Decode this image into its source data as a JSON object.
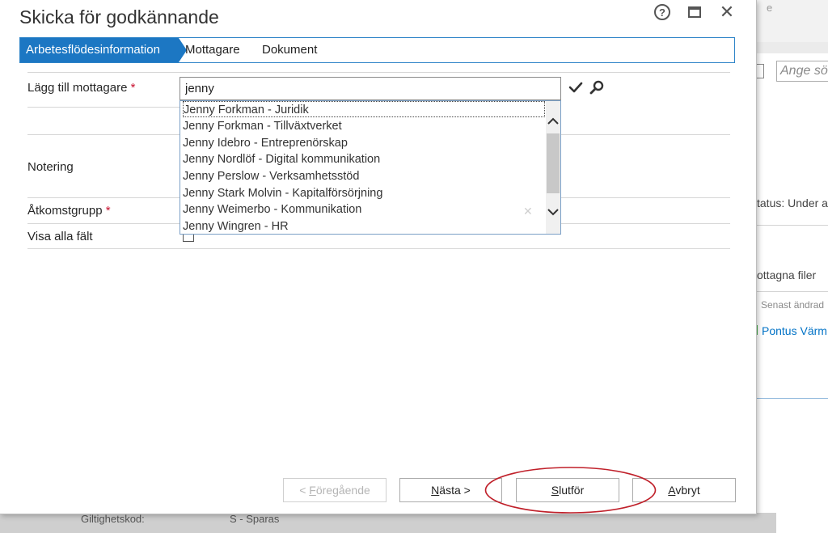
{
  "background": {
    "top_text": "e",
    "search_placeholder": "Ange sö",
    "status_text": "tatus: Under a",
    "files_heading": "ottagna filer",
    "last_changed": "Senast ändrad",
    "person_link": "Pontus Värm",
    "footer_label": "Giltighetskod:",
    "footer_value": "S - Sparas"
  },
  "dialog": {
    "title": "Skicka för godkännande",
    "help_glyph": "?",
    "close_glyph": "✕"
  },
  "tabs": [
    {
      "label": "Arbetesflödesinformation",
      "active": true
    },
    {
      "label": "Mottagare",
      "active": false
    },
    {
      "label": "Dokument",
      "active": false
    }
  ],
  "form": {
    "add_recipient_label": "Lägg till mottagare",
    "required_mark": "*",
    "recipient_value": "jenny",
    "note_label": "Notering",
    "access_group_label": "Åtkomstgrupp",
    "show_all_label": "Visa alla fält",
    "show_all_checked": false
  },
  "suggestions": [
    "Jenny Forkman - Juridik",
    "Jenny Forkman - Tillväxtverket",
    "Jenny Idebro - Entreprenörskap",
    "Jenny Nordlöf - Digital kommunikation",
    "Jenny Perslow - Verksamhetsstöd",
    "Jenny Stark Molvin - Kapitalförsörjning",
    "Jenny Weimerbo - Kommunikation",
    "Jenny Wingren - HR"
  ],
  "buttons": {
    "prev": {
      "pre": "< ",
      "key": "F",
      "post": "öregående",
      "enabled": false
    },
    "next": {
      "pre": "",
      "key": "N",
      "post": "ästa >",
      "enabled": true
    },
    "finish": {
      "pre": "",
      "key": "S",
      "post": "lutför",
      "enabled": true
    },
    "cancel": {
      "pre": "",
      "key": "A",
      "post": "vbryt",
      "enabled": true
    }
  },
  "colors": {
    "accent": "#1c77c3",
    "required": "#c8102e",
    "highlight_ellipse": "#c0202a",
    "link": "#0072c6"
  }
}
